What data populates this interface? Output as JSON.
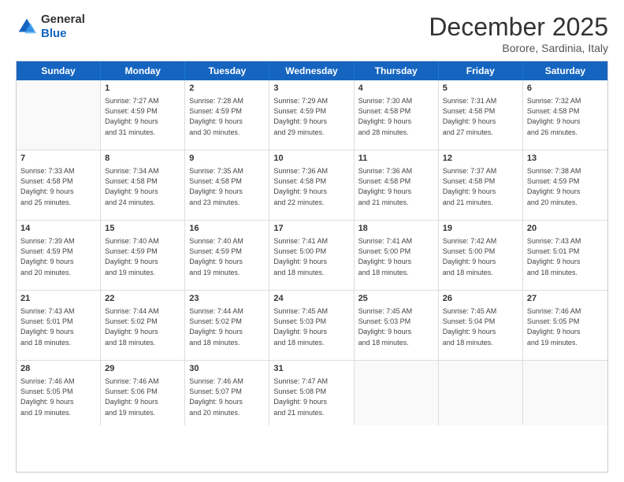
{
  "logo": {
    "general": "General",
    "blue": "Blue"
  },
  "header": {
    "month": "December 2025",
    "location": "Borore, Sardinia, Italy"
  },
  "weekdays": [
    "Sunday",
    "Monday",
    "Tuesday",
    "Wednesday",
    "Thursday",
    "Friday",
    "Saturday"
  ],
  "rows": [
    [
      {
        "day": "",
        "info": ""
      },
      {
        "day": "1",
        "info": "Sunrise: 7:27 AM\nSunset: 4:59 PM\nDaylight: 9 hours\nand 31 minutes."
      },
      {
        "day": "2",
        "info": "Sunrise: 7:28 AM\nSunset: 4:59 PM\nDaylight: 9 hours\nand 30 minutes."
      },
      {
        "day": "3",
        "info": "Sunrise: 7:29 AM\nSunset: 4:59 PM\nDaylight: 9 hours\nand 29 minutes."
      },
      {
        "day": "4",
        "info": "Sunrise: 7:30 AM\nSunset: 4:58 PM\nDaylight: 9 hours\nand 28 minutes."
      },
      {
        "day": "5",
        "info": "Sunrise: 7:31 AM\nSunset: 4:58 PM\nDaylight: 9 hours\nand 27 minutes."
      },
      {
        "day": "6",
        "info": "Sunrise: 7:32 AM\nSunset: 4:58 PM\nDaylight: 9 hours\nand 26 minutes."
      }
    ],
    [
      {
        "day": "7",
        "info": "Sunrise: 7:33 AM\nSunset: 4:58 PM\nDaylight: 9 hours\nand 25 minutes."
      },
      {
        "day": "8",
        "info": "Sunrise: 7:34 AM\nSunset: 4:58 PM\nDaylight: 9 hours\nand 24 minutes."
      },
      {
        "day": "9",
        "info": "Sunrise: 7:35 AM\nSunset: 4:58 PM\nDaylight: 9 hours\nand 23 minutes."
      },
      {
        "day": "10",
        "info": "Sunrise: 7:36 AM\nSunset: 4:58 PM\nDaylight: 9 hours\nand 22 minutes."
      },
      {
        "day": "11",
        "info": "Sunrise: 7:36 AM\nSunset: 4:58 PM\nDaylight: 9 hours\nand 21 minutes."
      },
      {
        "day": "12",
        "info": "Sunrise: 7:37 AM\nSunset: 4:58 PM\nDaylight: 9 hours\nand 21 minutes."
      },
      {
        "day": "13",
        "info": "Sunrise: 7:38 AM\nSunset: 4:59 PM\nDaylight: 9 hours\nand 20 minutes."
      }
    ],
    [
      {
        "day": "14",
        "info": "Sunrise: 7:39 AM\nSunset: 4:59 PM\nDaylight: 9 hours\nand 20 minutes."
      },
      {
        "day": "15",
        "info": "Sunrise: 7:40 AM\nSunset: 4:59 PM\nDaylight: 9 hours\nand 19 minutes."
      },
      {
        "day": "16",
        "info": "Sunrise: 7:40 AM\nSunset: 4:59 PM\nDaylight: 9 hours\nand 19 minutes."
      },
      {
        "day": "17",
        "info": "Sunrise: 7:41 AM\nSunset: 5:00 PM\nDaylight: 9 hours\nand 18 minutes."
      },
      {
        "day": "18",
        "info": "Sunrise: 7:41 AM\nSunset: 5:00 PM\nDaylight: 9 hours\nand 18 minutes."
      },
      {
        "day": "19",
        "info": "Sunrise: 7:42 AM\nSunset: 5:00 PM\nDaylight: 9 hours\nand 18 minutes."
      },
      {
        "day": "20",
        "info": "Sunrise: 7:43 AM\nSunset: 5:01 PM\nDaylight: 9 hours\nand 18 minutes."
      }
    ],
    [
      {
        "day": "21",
        "info": "Sunrise: 7:43 AM\nSunset: 5:01 PM\nDaylight: 9 hours\nand 18 minutes."
      },
      {
        "day": "22",
        "info": "Sunrise: 7:44 AM\nSunset: 5:02 PM\nDaylight: 9 hours\nand 18 minutes."
      },
      {
        "day": "23",
        "info": "Sunrise: 7:44 AM\nSunset: 5:02 PM\nDaylight: 9 hours\nand 18 minutes."
      },
      {
        "day": "24",
        "info": "Sunrise: 7:45 AM\nSunset: 5:03 PM\nDaylight: 9 hours\nand 18 minutes."
      },
      {
        "day": "25",
        "info": "Sunrise: 7:45 AM\nSunset: 5:03 PM\nDaylight: 9 hours\nand 18 minutes."
      },
      {
        "day": "26",
        "info": "Sunrise: 7:45 AM\nSunset: 5:04 PM\nDaylight: 9 hours\nand 18 minutes."
      },
      {
        "day": "27",
        "info": "Sunrise: 7:46 AM\nSunset: 5:05 PM\nDaylight: 9 hours\nand 19 minutes."
      }
    ],
    [
      {
        "day": "28",
        "info": "Sunrise: 7:46 AM\nSunset: 5:05 PM\nDaylight: 9 hours\nand 19 minutes."
      },
      {
        "day": "29",
        "info": "Sunrise: 7:46 AM\nSunset: 5:06 PM\nDaylight: 9 hours\nand 19 minutes."
      },
      {
        "day": "30",
        "info": "Sunrise: 7:46 AM\nSunset: 5:07 PM\nDaylight: 9 hours\nand 20 minutes."
      },
      {
        "day": "31",
        "info": "Sunrise: 7:47 AM\nSunset: 5:08 PM\nDaylight: 9 hours\nand 21 minutes."
      },
      {
        "day": "",
        "info": ""
      },
      {
        "day": "",
        "info": ""
      },
      {
        "day": "",
        "info": ""
      }
    ]
  ]
}
